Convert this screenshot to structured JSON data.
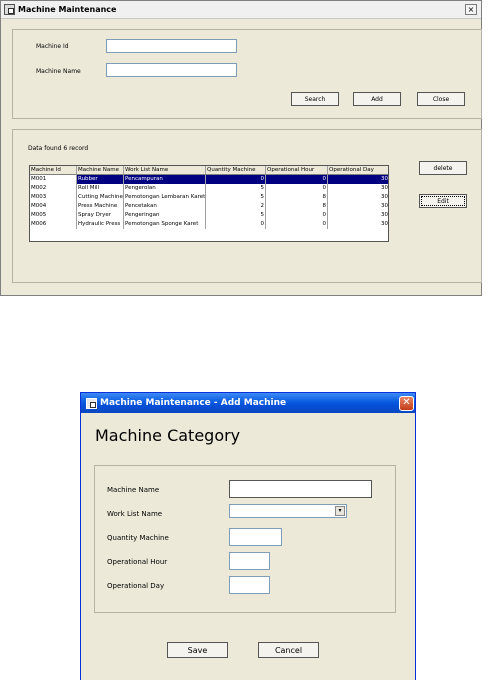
{
  "window_main": {
    "title": "Machine Maintenance",
    "close_glyph": "×",
    "fields": {
      "machine_id_label": "Machine Id",
      "machine_id_value": "",
      "machine_name_label": "Machine Name",
      "machine_name_value": ""
    },
    "buttons": {
      "search": "Search",
      "add": "Add",
      "close": "Close",
      "delete": "delete",
      "edit": "Edit"
    },
    "status_text": "Data found 6 record",
    "grid": {
      "columns": [
        "Machine Id",
        "Machine Name",
        "Work List Name",
        "Quantity Machine",
        "Operational Hour",
        "Operational Day"
      ],
      "rows": [
        [
          "M001",
          "Rubber",
          "Pencampuran",
          "0",
          "0",
          "30"
        ],
        [
          "M002",
          "Roll Mill",
          "Pengerolan",
          "5",
          "0",
          "30"
        ],
        [
          "M003",
          "Cutting Machine",
          "Pemotongan Lembaran Karet",
          "5",
          "8",
          "30"
        ],
        [
          "M004",
          "Press Machine",
          "Pencetakan",
          "2",
          "8",
          "30"
        ],
        [
          "M005",
          "Spray Dryer",
          "Pengeringan",
          "5",
          "0",
          "30"
        ],
        [
          "M006",
          "Hydraulic Press",
          "Pemotongan Sponge Karet",
          "0",
          "0",
          "30"
        ]
      ]
    }
  },
  "window_add": {
    "title": "Machine Maintenance - Add Machine",
    "close_glyph": "✕",
    "heading": "Machine Category",
    "fields": {
      "machine_name_label": "Machine Name",
      "work_list_label": "Work List Name",
      "quantity_label": "Quantity Machine",
      "operational_hour_label": "Operational Hour",
      "operational_day_label": "Operational Day"
    },
    "dropdown_arrow": "▾",
    "buttons": {
      "save": "Save",
      "cancel": "Cancel"
    }
  }
}
